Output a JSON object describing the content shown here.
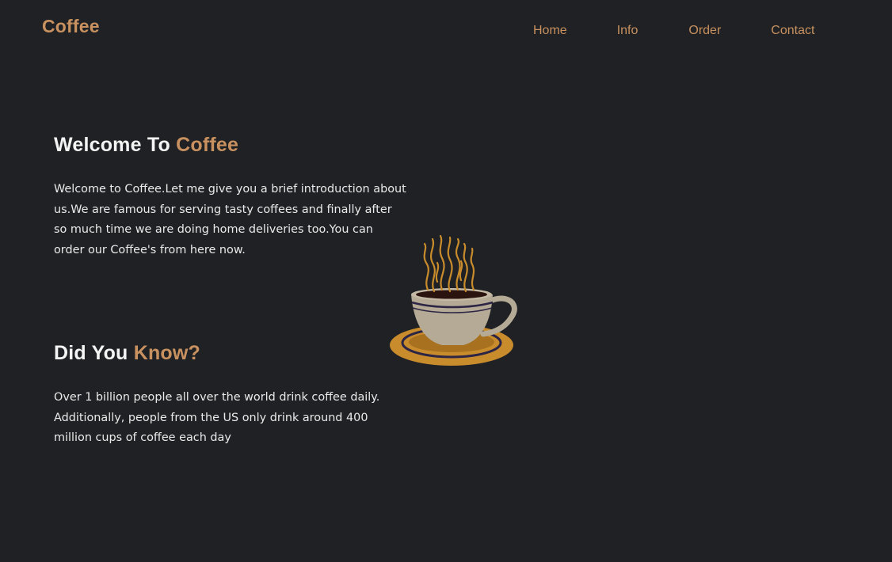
{
  "header": {
    "brand": "Coffee",
    "nav": [
      {
        "label": "Home"
      },
      {
        "label": "Info"
      },
      {
        "label": "Order"
      },
      {
        "label": "Contact"
      }
    ]
  },
  "welcome": {
    "title_main": "Welcome To ",
    "title_accent": "Coffee",
    "body": "Welcome to Coffee.Let me give you a brief introduction about us.We are famous for serving tasty coffees and finally after so much time we are doing home deliveries too.You can order our Coffee's from here now."
  },
  "did_you_know": {
    "title_main": "Did You ",
    "title_accent": "Know?",
    "body": "Over 1 billion people all over the world drink coffee daily. Additionally, people from the US only drink around 400 million cups of coffee each day"
  },
  "illustration": {
    "icon": "coffee-cup-icon"
  },
  "colors": {
    "background": "#1f2124",
    "accent": "#c8915f",
    "text": "#eaeaea"
  }
}
